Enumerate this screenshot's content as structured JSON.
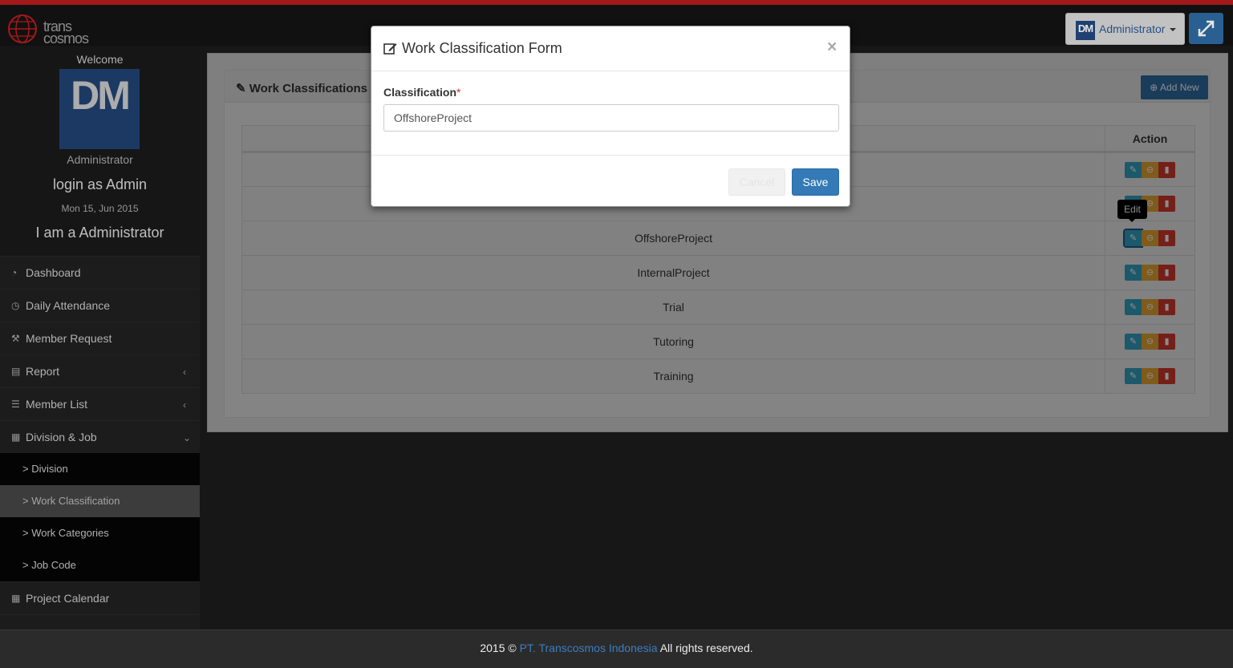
{
  "header": {
    "logo_line1": "trans",
    "logo_line2": "cosmos",
    "user_initials": "DM",
    "user_menu_label": "Administrator"
  },
  "sidebar": {
    "welcome": "Welcome",
    "avatar_initials": "DM",
    "role": "Administrator",
    "login_as": "login as Admin",
    "date": "Mon 15, Jun 2015",
    "i_am": "I am a Administrator",
    "menu": [
      {
        "label": "Dashboard",
        "icon": "dashboard-icon"
      },
      {
        "label": "Daily Attendance",
        "icon": "clock-icon"
      },
      {
        "label": "Member Request",
        "icon": "gavel-icon"
      },
      {
        "label": "Report",
        "icon": "book-icon",
        "arrow": "‹"
      },
      {
        "label": "Member List",
        "icon": "list-icon",
        "arrow": "‹"
      },
      {
        "label": "Division & Job",
        "icon": "newspaper-icon",
        "arrow": "⌄"
      }
    ],
    "submenu": [
      {
        "label": "> Division"
      },
      {
        "label": "> Work Classification"
      },
      {
        "label": "> Work Categories"
      },
      {
        "label": "> Job Code"
      }
    ],
    "menu_after": [
      {
        "label": "Project Calendar",
        "icon": "calendar-icon"
      }
    ]
  },
  "panel": {
    "title": "Work Classifications",
    "add_new": "Add New",
    "action_header": "Action",
    "rows": [
      "",
      "",
      "OffshoreProject",
      "InternalProject",
      "Trial",
      "Tutoring",
      "Training"
    ]
  },
  "tooltip": "Edit",
  "modal": {
    "title": "Work Classification Form",
    "close": "×",
    "field_label": "Classification",
    "required_mark": "*",
    "field_value": "OffshoreProject",
    "cancel_label": "Cancel",
    "save_label": "Save"
  },
  "footer": {
    "prefix": "2015 ©",
    "company": "PT. Transcosmos Indonesia",
    "suffix": "All rights reserved."
  }
}
